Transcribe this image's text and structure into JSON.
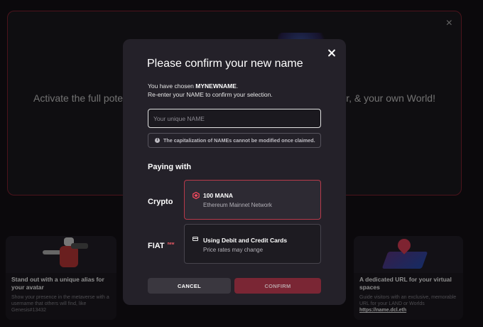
{
  "background": {
    "banner_left_text": "Activate the full potentia",
    "banner_right_text": "ower, & your own World!",
    "banner_close": "×",
    "card_left": {
      "title": "Stand out with a unique alias for your avatar",
      "desc": "Show your presence in the metaverse with a username that others will find, like Genesis#13432"
    },
    "card_right": {
      "title": "A dedicated URL for your virtual spaces",
      "desc": "Guide visitors with an exclusive, memorable URL for your LAND or Worlds",
      "link": "https://name.dcl.eth"
    }
  },
  "modal": {
    "title": "Please confirm your new name",
    "chosen_prefix": "You have chosen ",
    "chosen_name": "MYNEWNAME",
    "chosen_suffix": ".",
    "reenter_text": "Re-enter your NAME to confirm your selection.",
    "input": {
      "value": "",
      "placeholder": "Your unique NAME"
    },
    "warning": "The capitalization of NAMEs cannot be modified once claimed.",
    "paying_with": "Paying with",
    "crypto": {
      "label": "Crypto",
      "option_title": "100 MANA",
      "option_sub": "Ethereum Mainnet Network",
      "selected": true
    },
    "fiat": {
      "label": "FIAT",
      "badge": "new",
      "option_title": "Using Debit and Credit Cards",
      "option_sub": "Price rates may change",
      "selected": false
    },
    "cancel_label": "CANCEL",
    "confirm_label": "CONFIRM",
    "confirm_enabled": false
  },
  "colors": {
    "accent": "#b73a4a",
    "modal_bg": "#242129",
    "confirm_disabled": "#7a2634"
  }
}
